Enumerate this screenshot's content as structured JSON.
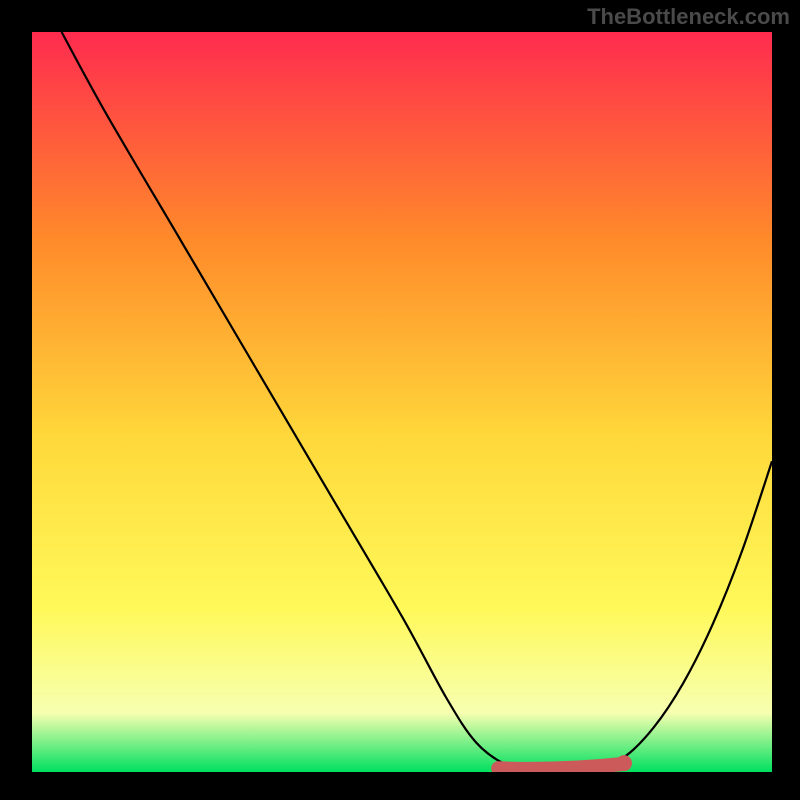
{
  "watermark": "TheBottleneck.com",
  "colors": {
    "frame": "#000000",
    "watermark": "#4a4a4a",
    "gradient_top": "#ff2b4f",
    "gradient_upper_mid": "#ff8a2a",
    "gradient_mid": "#ffd93b",
    "gradient_lower_mid": "#fff95a",
    "gradient_low": "#f7ffb0",
    "gradient_bottom": "#00e060",
    "curve": "#000000",
    "marker_stroke": "#cc5a5a",
    "marker_fill": "#cc5a5a"
  },
  "chart_data": {
    "type": "line",
    "title": "",
    "xlabel": "",
    "ylabel": "",
    "xlim": [
      0,
      100
    ],
    "ylim": [
      0,
      100
    ],
    "series": [
      {
        "name": "bottleneck-curve",
        "x": [
          4,
          10,
          20,
          30,
          40,
          50,
          56,
          60,
          64,
          68,
          72,
          76,
          80,
          84,
          88,
          92,
          96,
          100
        ],
        "y": [
          100,
          89,
          72,
          55,
          38,
          21,
          10,
          4,
          1,
          0,
          0,
          0.5,
          2,
          6,
          12,
          20,
          30,
          42
        ]
      }
    ],
    "marker_band": {
      "comment": "flat highlighted segment near the minimum",
      "x_start": 63,
      "x_end": 80,
      "y": 0.5,
      "end_dot": {
        "x": 80,
        "y": 1.2
      }
    }
  }
}
